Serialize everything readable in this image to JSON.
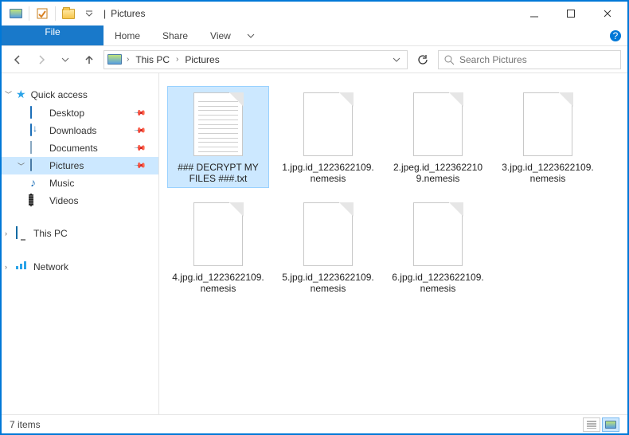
{
  "title": "Pictures",
  "titlebar": {
    "divider": "|"
  },
  "ribbon": {
    "file": "File",
    "tabs": [
      "Home",
      "Share",
      "View"
    ]
  },
  "breadcrumb": {
    "segments": [
      "This PC",
      "Pictures"
    ]
  },
  "search": {
    "placeholder": "Search Pictures"
  },
  "sidebar": {
    "quick_access": "Quick access",
    "quick_items": [
      {
        "label": "Desktop",
        "pinned": true,
        "icon": "desktop"
      },
      {
        "label": "Downloads",
        "pinned": true,
        "icon": "down"
      },
      {
        "label": "Documents",
        "pinned": true,
        "icon": "doc"
      },
      {
        "label": "Pictures",
        "pinned": true,
        "icon": "pic",
        "selected": true
      },
      {
        "label": "Music",
        "pinned": false,
        "icon": "music"
      },
      {
        "label": "Videos",
        "pinned": false,
        "icon": "video"
      }
    ],
    "this_pc": "This PC",
    "network": "Network"
  },
  "files": [
    {
      "label": "### DECRYPT MY FILES ###.txt",
      "type": "txt",
      "selected": true
    },
    {
      "label": "1.jpg.id_1223622109.nemesis",
      "type": "blank"
    },
    {
      "label": "2.jpeg.id_1223622109.nemesis",
      "type": "blank"
    },
    {
      "label": "3.jpg.id_1223622109.nemesis",
      "type": "blank"
    },
    {
      "label": "4.jpg.id_1223622109.nemesis",
      "type": "blank"
    },
    {
      "label": "5.jpg.id_1223622109.nemesis",
      "type": "blank"
    },
    {
      "label": "6.jpg.id_1223622109.nemesis",
      "type": "blank"
    }
  ],
  "status": {
    "count_text": "7 items"
  }
}
